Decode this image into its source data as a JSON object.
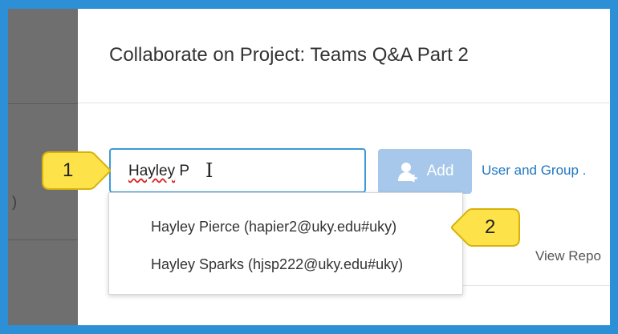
{
  "modal": {
    "title": "Collaborate on Project: Teams Q&A Part 2"
  },
  "search": {
    "typed_prefix": "Hayley",
    "typed_suffix": " P"
  },
  "add_button": {
    "label": "Add"
  },
  "user_group_link": "User and Group .",
  "suggestions": [
    "Hayley Pierce (hapier2@uky.edu#uky)",
    "Hayley Sparks (hjsp222@uky.edu#uky)"
  ],
  "background_text": {
    "view_reports": "View Repo",
    "paren": ")"
  },
  "callouts": {
    "one": "1",
    "two": "2"
  },
  "colors": {
    "outer_border": "#2d8fd6",
    "callout_fill": "#fde24a",
    "link": "#1f77c0",
    "add_button": "#a7c8ea"
  }
}
